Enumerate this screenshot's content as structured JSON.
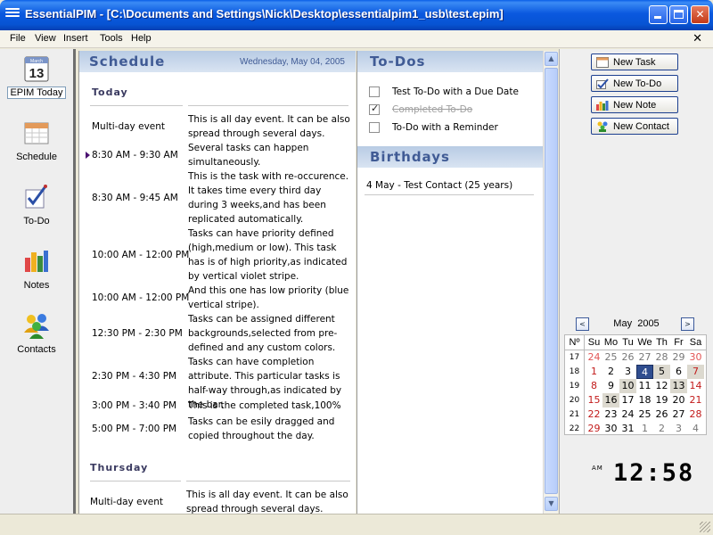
{
  "window": {
    "title": "EssentialPIM - [C:\\Documents and Settings\\Nick\\Desktop\\essentialpim1_usb\\test.epim]"
  },
  "menu": {
    "items": [
      "File",
      "View",
      "Insert",
      "Tools",
      "Help"
    ],
    "close_glyph": "✕"
  },
  "sidebar": {
    "items": [
      {
        "label": "EPIM Today",
        "icon": "calendar-13-icon",
        "active": true
      },
      {
        "label": "Schedule",
        "icon": "schedule-icon"
      },
      {
        "label": "To-Do",
        "icon": "todo-check-icon"
      },
      {
        "label": "Notes",
        "icon": "notes-icon"
      },
      {
        "label": "Contacts",
        "icon": "contacts-icon"
      }
    ],
    "calendar_icon_month": "March",
    "calendar_icon_day": "13"
  },
  "schedule": {
    "heading": "Schedule",
    "date": "Wednesday, May 04, 2005",
    "days": [
      {
        "title": "Today",
        "events": [
          {
            "time": "Multi-day event",
            "text": "This is all day event. It can be also spread through several days."
          },
          {
            "time": "8:30 AM - 9:30 AM",
            "text": "Several tasks can happen simultaneously.",
            "marker": true
          },
          {
            "time": "8:30 AM - 9:45 AM",
            "text": "This is the task with re-occurence. It takes time every third day during 3 weeks,and has been replicated automatically."
          },
          {
            "time": "10:00 AM - 12:00 PM",
            "text": "Tasks can have priority defined (high,medium or low). This task has is of high priority,as indicated by vertical violet stripe."
          },
          {
            "time": "10:00 AM - 12:00 PM",
            "text": "And this one has low priority (blue vertical stripe)."
          },
          {
            "time": "12:30 PM - 2:30 PM",
            "text": "Tasks can be assigned different backgrounds,selected from pre-defined and any custom colors."
          },
          {
            "time": "2:30 PM - 4:30 PM",
            "text": "Tasks can have completion attribute. This particular tasks is half-way through,as indicated by the bar."
          },
          {
            "time": "3:00 PM - 3:40 PM",
            "text": "This is the completed task,100%"
          },
          {
            "time": "5:00 PM - 7:00 PM",
            "text": "Tasks can be esily dragged and copied throughout the day."
          }
        ]
      },
      {
        "title": "Thursday",
        "events": [
          {
            "time": "Multi-day event",
            "text": "This is all day event. It can be also spread through several days."
          }
        ]
      }
    ]
  },
  "todos": {
    "heading": "To-Dos",
    "items": [
      {
        "label": "Test To-Do with a Due Date",
        "checked": false
      },
      {
        "label": "Completed To-Do",
        "checked": true
      },
      {
        "label": "To-Do with a Reminder",
        "checked": false
      }
    ]
  },
  "birthdays": {
    "heading": "Birthdays",
    "entries": [
      "4 May  -  Test Contact  (25 years)"
    ]
  },
  "actions": {
    "buttons": [
      {
        "label": "New Task",
        "icon": "new-task-icon"
      },
      {
        "label": "New To-Do",
        "icon": "new-todo-icon"
      },
      {
        "label": "New Note",
        "icon": "new-note-icon"
      },
      {
        "label": "New Contact",
        "icon": "new-contact-icon"
      }
    ]
  },
  "mini_calendar": {
    "month": "May",
    "year": "2005",
    "prev": "<",
    "next": ">",
    "week_header": "Nº",
    "day_headers": [
      "Su",
      "Mo",
      "Tu",
      "We",
      "Th",
      "Fr",
      "Sa"
    ],
    "weeks": [
      {
        "num": "17",
        "days": [
          "24",
          "25",
          "26",
          "27",
          "28",
          "29",
          "30"
        ]
      },
      {
        "num": "18",
        "days": [
          "1",
          "2",
          "3",
          "4",
          "5",
          "6",
          "7"
        ]
      },
      {
        "num": "19",
        "days": [
          "8",
          "9",
          "10",
          "11",
          "12",
          "13",
          "14"
        ]
      },
      {
        "num": "20",
        "days": [
          "15",
          "16",
          "17",
          "18",
          "19",
          "20",
          "21"
        ]
      },
      {
        "num": "21",
        "days": [
          "22",
          "23",
          "24",
          "25",
          "26",
          "27",
          "28"
        ]
      },
      {
        "num": "22",
        "days": [
          "29",
          "30",
          "31",
          "1",
          "2",
          "3",
          "4"
        ]
      }
    ],
    "selected_day": "4"
  },
  "clock": {
    "ampm": "AM",
    "time": "12:58"
  },
  "colors": {
    "title_bar": "#0754d3",
    "panel_heading": "#405b95",
    "priority_marker": "#4a1070",
    "today_cell": "#2f4d8f",
    "weekend_text": "#c21a1a"
  }
}
